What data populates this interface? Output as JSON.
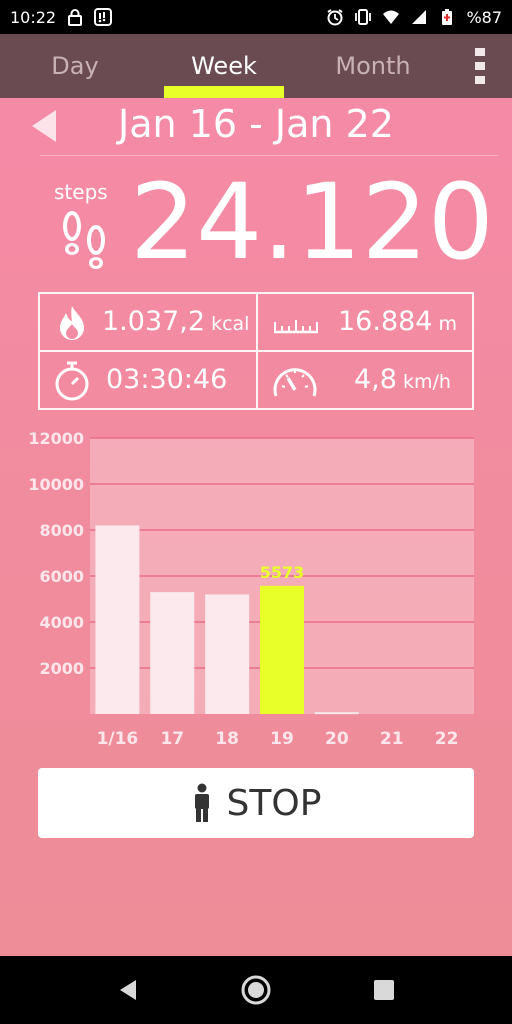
{
  "status_bar": {
    "time": "10:22",
    "battery": "%87",
    "icons": [
      "lock-icon",
      "notification-app-icon",
      "alarm-icon",
      "vibrate-icon",
      "wifi-icon",
      "signal-icon",
      "battery-icon"
    ]
  },
  "tabs": [
    {
      "label": "Day",
      "active": false
    },
    {
      "label": "Week",
      "active": true
    },
    {
      "label": "Month",
      "active": false
    }
  ],
  "header": {
    "range": "Jan 16 - Jan 22"
  },
  "steps": {
    "label": "steps",
    "value": "24.120"
  },
  "stats": {
    "kcal": {
      "value": "1.037,2",
      "unit": "kcal"
    },
    "distance": {
      "value": "16.884",
      "unit": "m"
    },
    "time": {
      "value": "03:30:46"
    },
    "speed": {
      "value": "4,8",
      "unit": "km/h"
    }
  },
  "chart_data": {
    "type": "bar",
    "categories": [
      "1/16",
      "17",
      "18",
      "19",
      "20",
      "21",
      "22"
    ],
    "values": [
      8200,
      5300,
      5200,
      5573,
      80,
      0,
      0
    ],
    "highlight_index": 3,
    "highlight_label": "5573",
    "y_ticks": [
      "2000",
      "4000",
      "6000",
      "8000",
      "10000",
      "12000"
    ],
    "ylim": [
      0,
      12000
    ],
    "grid": true,
    "colors": {
      "bar": "#fbe9ee",
      "highlight": "#e8ff2a",
      "highlight_label": "#e8ff2a",
      "grid": "#e86f88"
    }
  },
  "stop_button": {
    "label": "STOP"
  },
  "colors": {
    "accent": "#e8ff2a",
    "tab_bar": "#6a4b52",
    "background": "#f38aa2"
  }
}
